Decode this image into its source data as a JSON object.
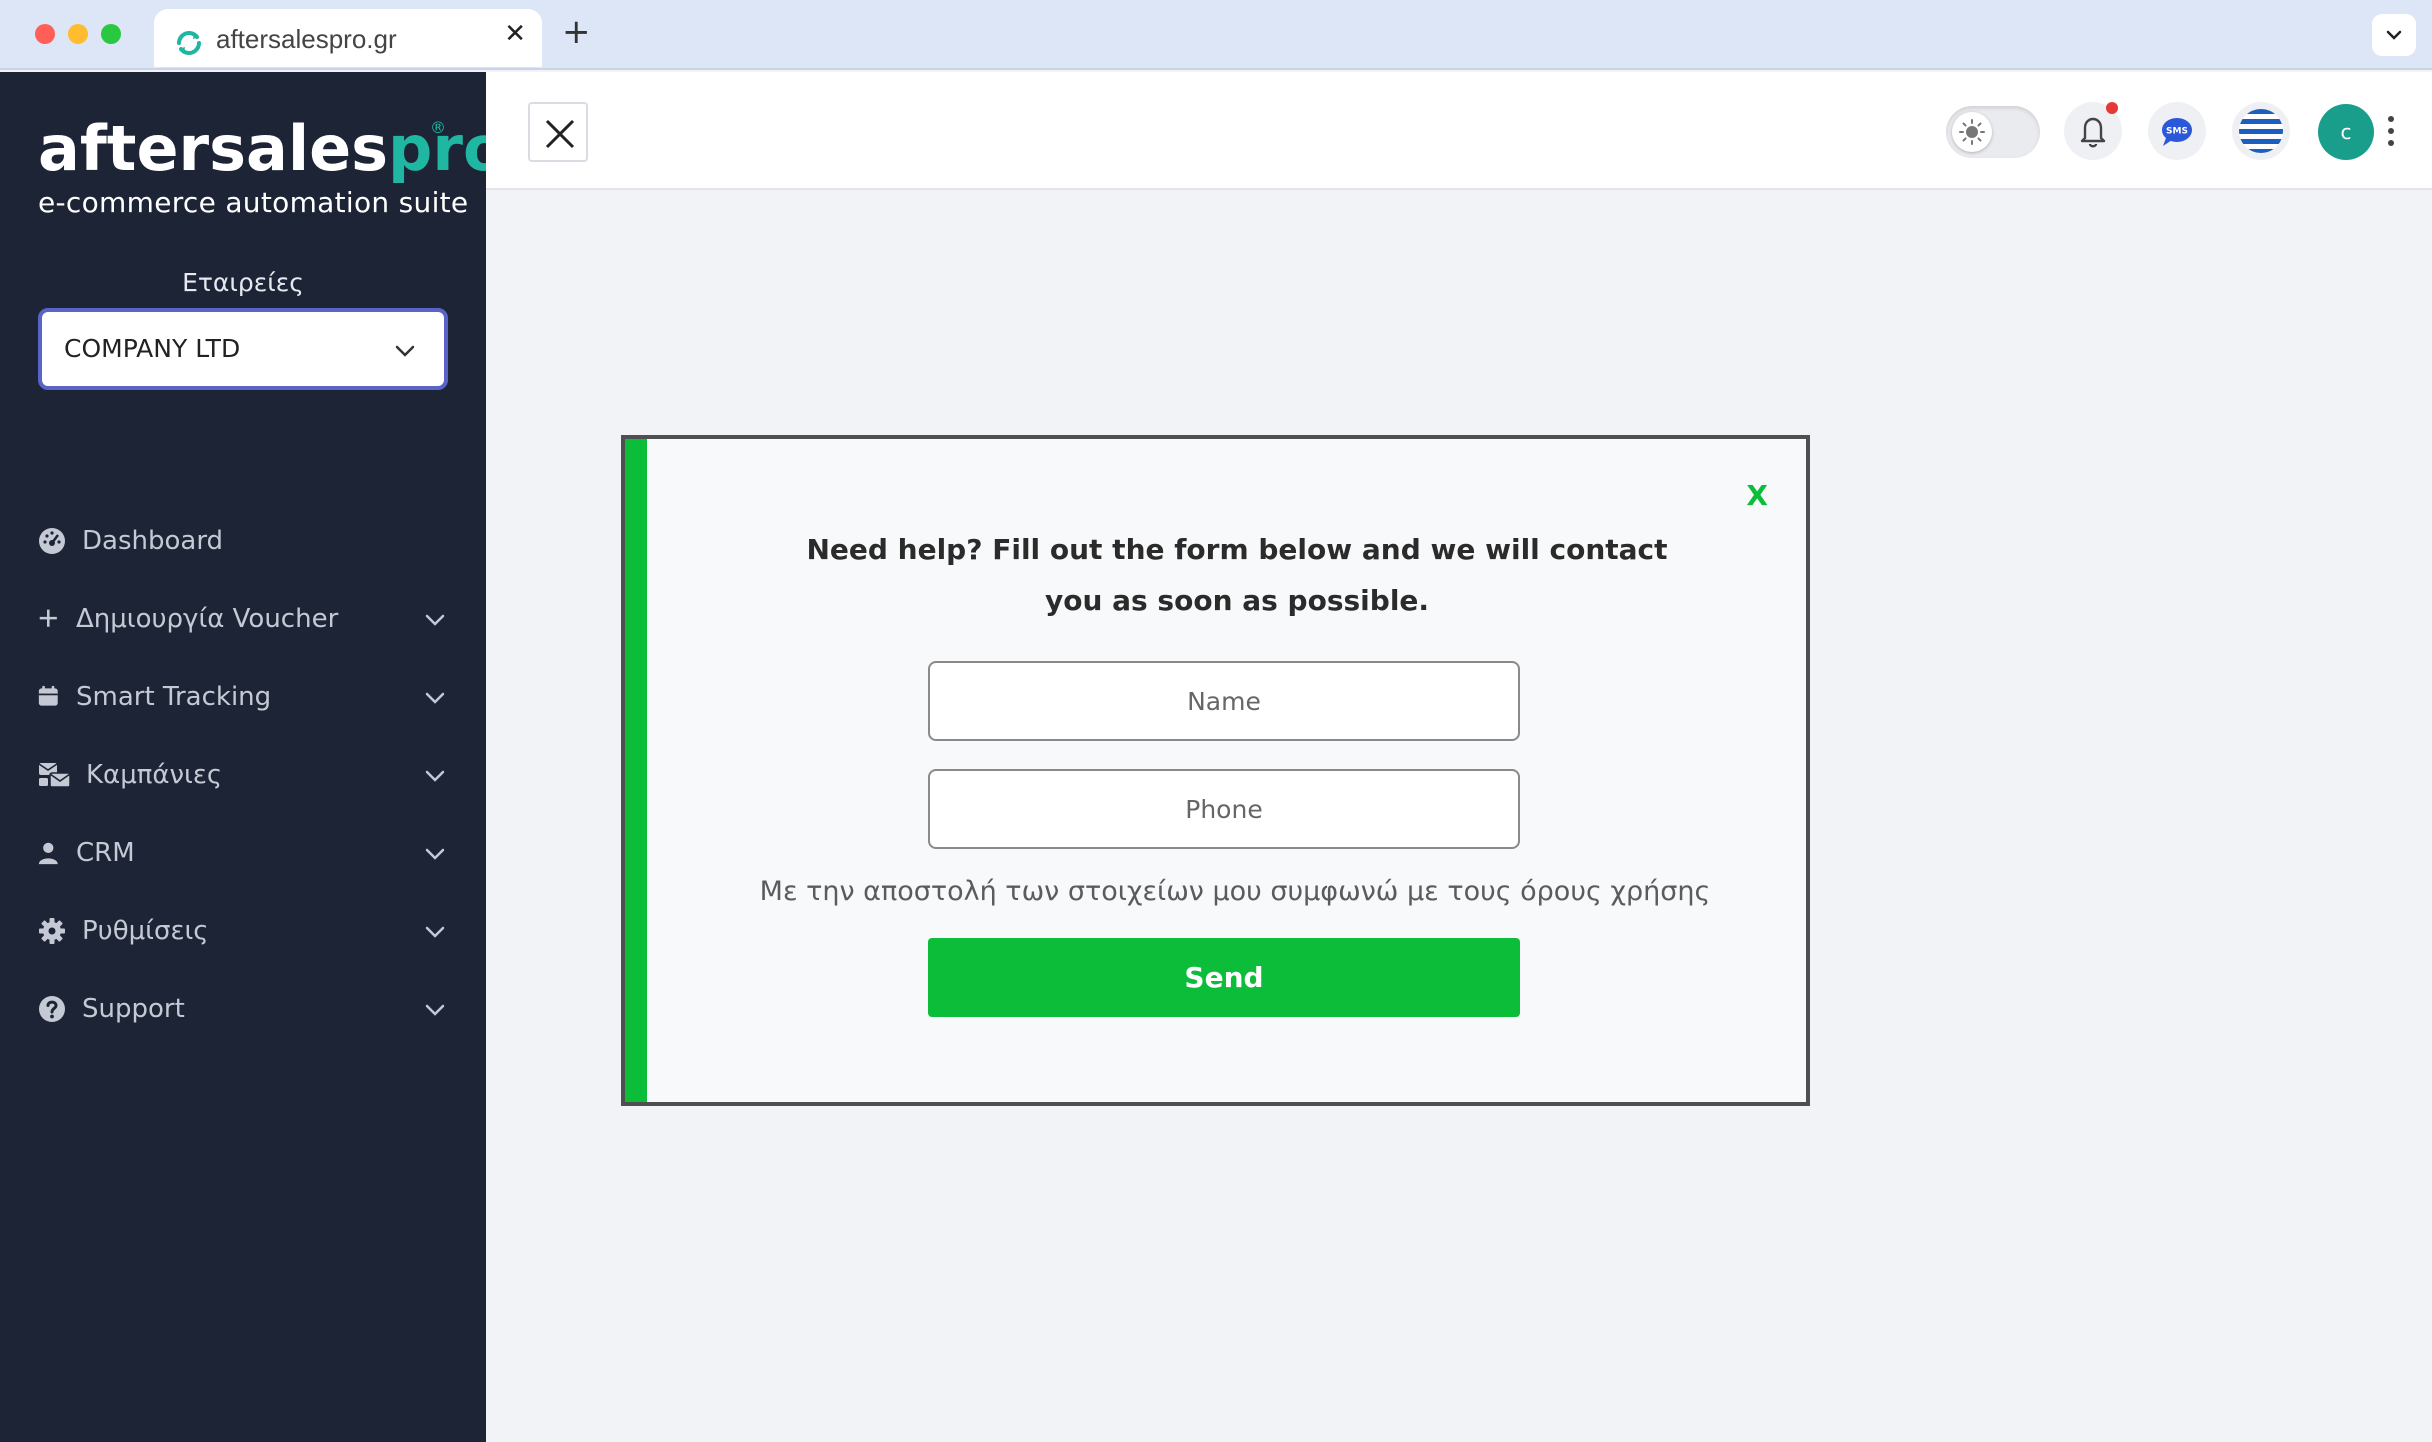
{
  "browser": {
    "tab_title": "aftersalespro.gr",
    "tab_close": "✕",
    "new_tab": "+",
    "menu_glyph": "⌄"
  },
  "sidebar": {
    "logo": {
      "main_left": "aftersales",
      "main_right": "pro",
      "registered": "®",
      "tagline": "e-commerce automation suite"
    },
    "company_label": "Εταιρείες",
    "company_value": "COMPANY LTD",
    "items": [
      {
        "label": "Dashboard",
        "icon": "dashboard-gauge-icon",
        "has_submenu": false
      },
      {
        "label": "Δημιουργία Voucher",
        "icon": "plus-icon",
        "has_submenu": true
      },
      {
        "label": "Smart Tracking",
        "icon": "calendar-icon",
        "has_submenu": true
      },
      {
        "label": "Καμπάνιες",
        "icon": "mail-bulk-icon",
        "has_submenu": true
      },
      {
        "label": "CRM",
        "icon": "user-icon",
        "has_submenu": true
      },
      {
        "label": "Ρυθμίσεις",
        "icon": "gear-icon",
        "has_submenu": true
      },
      {
        "label": "Support",
        "icon": "question-circle-icon",
        "has_submenu": true
      }
    ]
  },
  "topbar": {
    "avatar_initial": "c",
    "icons": [
      "close-icon",
      "theme-toggle-icon",
      "bell-icon",
      "sms-icon",
      "greek-flag-icon",
      "kebab-menu-icon"
    ]
  },
  "modal": {
    "close_label": "X",
    "heading": "Need help? Fill out the form below and we will contact you as soon as possible.",
    "name_placeholder": "Name",
    "phone_placeholder": "Phone",
    "terms": "Με την αποστολή των στοιχείων μου συμφωνώ με τους όρους χρήσης",
    "send_label": "Send"
  },
  "colors": {
    "sidebar_bg": "#1d2436",
    "brand_teal": "#1fb7a1",
    "modal_green": "#0bbd39",
    "notification_red": "#e53935",
    "select_border": "#5a63c6"
  }
}
